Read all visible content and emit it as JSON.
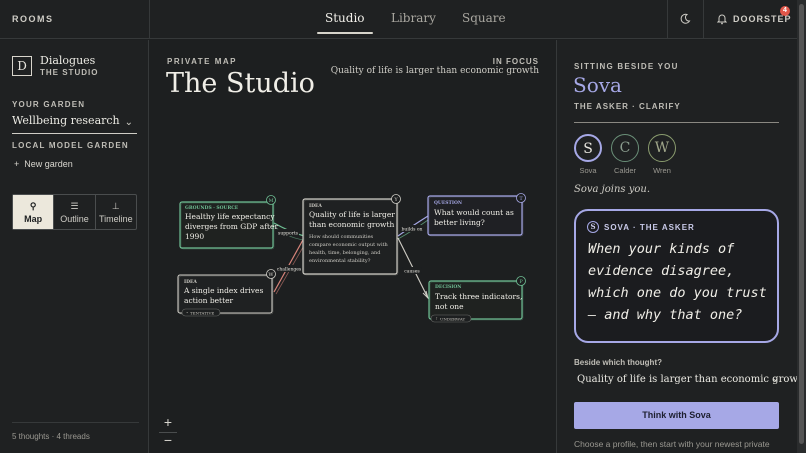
{
  "header": {
    "rooms_label": "ROOMS",
    "tabs": [
      {
        "label": "Studio",
        "active": true
      },
      {
        "label": "Library",
        "active": false
      },
      {
        "label": "Square",
        "active": false
      }
    ],
    "theme_icon": "moon-icon",
    "notification_icon": "bell-icon",
    "doorstep_label": "DOORSTEP",
    "doorstep_badge": "4"
  },
  "sidebar": {
    "logo_letter": "D",
    "brand_title": "Dialogues",
    "brand_subtitle": "THE STUDIO",
    "garden_label": "YOUR GARDEN",
    "garden_value": "Wellbeing research",
    "local_label": "LOCAL MODEL GARDEN",
    "new_garden": "New garden",
    "views": [
      {
        "label": "Map",
        "icon": "map-icon",
        "active": true
      },
      {
        "label": "Outline",
        "icon": "outline-icon",
        "active": false
      },
      {
        "label": "Timeline",
        "icon": "timeline-icon",
        "active": false
      }
    ],
    "footer": "5 thoughts · 4 threads"
  },
  "canvas": {
    "kicker": "PRIVATE MAP",
    "title": "The Studio",
    "focus_label": "IN FOCUS",
    "focus_text": "Quality of life is larger than economic growth",
    "zoom_in": "+",
    "zoom_out": "−",
    "nodes": [
      {
        "id": "n1",
        "tag": "GROUNDS · SOURCE",
        "text": [
          "Healthy life expectancy",
          "diverges from GDP after",
          "1990"
        ],
        "badge": "M",
        "color": "#6fbf94"
      },
      {
        "id": "n2",
        "tag": "IDEA",
        "text": [
          "A single index drives",
          "action better"
        ],
        "badge": "W",
        "pill": "TENTATIVE",
        "color": "#cfcdc6"
      },
      {
        "id": "n3",
        "tag": "IDEA",
        "text": [
          "Quality of life is larger",
          "than economic growth"
        ],
        "sub": [
          "How should communities",
          "compare economic output with",
          "health, time, belonging, and",
          "environmental stability?"
        ],
        "badge": "Y",
        "color": "#cfcdc6"
      },
      {
        "id": "n4",
        "tag": "QUESTION",
        "text": [
          "What would count as",
          "better living?"
        ],
        "badge": "T",
        "color": "#a6a8e6"
      },
      {
        "id": "n5",
        "tag": "DECISION",
        "text": [
          "Track three indicators,",
          "not one"
        ],
        "badge": "P",
        "pill": "UNDERWAY",
        "color": "#6fbf94"
      }
    ],
    "edges": [
      {
        "label": "supports",
        "color": "#6fbf94"
      },
      {
        "label": "challenges",
        "color": "#d8847a"
      },
      {
        "label": "builds on",
        "color": "#a6a8e6"
      },
      {
        "label": "causes",
        "color": "#cfcdc6"
      }
    ]
  },
  "panel": {
    "kicker": "SITTING BESIDE YOU",
    "name": "Sova",
    "role": "THE ASKER · CLARIFY",
    "profiles": [
      {
        "letter": "S",
        "name": "Sova",
        "color": "#a6a8e6",
        "active": true
      },
      {
        "letter": "C",
        "name": "Calder",
        "color": "#6a8f78",
        "active": false
      },
      {
        "letter": "W",
        "name": "Wren",
        "color": "#8a9c6e",
        "active": false
      }
    ],
    "joins": "Sova joins you.",
    "bubble_letter": "S",
    "bubble_header": "SOVA · THE ASKER",
    "question": "When your kinds of evidence disagree, which one do you trust — and why that one?",
    "beside_label": "Beside which thought?",
    "beside_value": "Quality of life is larger than economic growth",
    "think_button": "Think with Sova",
    "hint": "Choose a profile, then start with your newest private"
  }
}
